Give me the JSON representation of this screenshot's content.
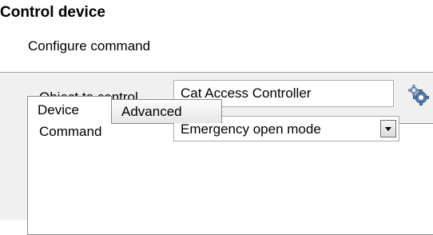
{
  "header": {
    "title": "Control device",
    "subtitle": "Configure command"
  },
  "tabs": [
    {
      "label": "Device",
      "selected": true
    },
    {
      "label": "Advanced",
      "selected": false
    }
  ],
  "form": {
    "object_label": "Object to control",
    "object_value": "Cat Access Controller",
    "object_button_icon": "gears-icon",
    "command_label": "Command",
    "command_value": "Emergency open mode"
  }
}
